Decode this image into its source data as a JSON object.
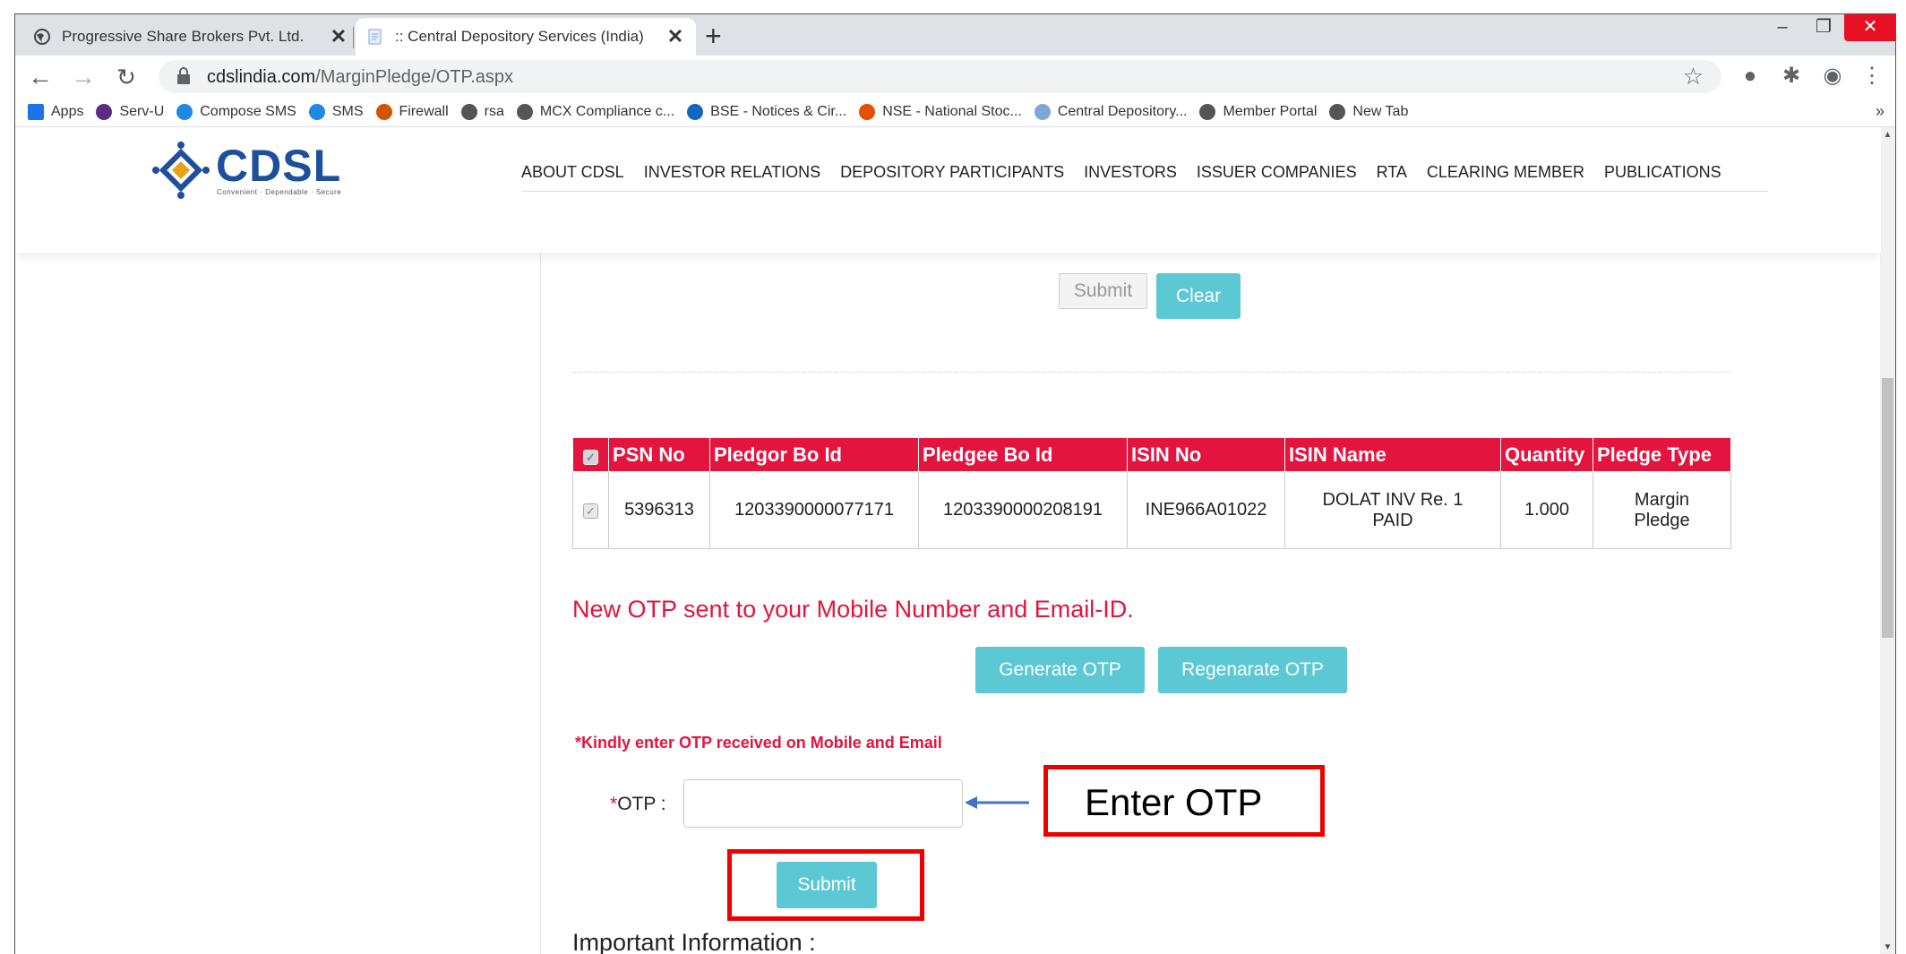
{
  "browser": {
    "tabs": [
      {
        "title": "Progressive Share Brokers Pvt. Ltd.",
        "active": false
      },
      {
        "title": ":: Central Depository Services (India)",
        "active": true
      }
    ],
    "new_tab_symbol": "+",
    "window_controls": {
      "minimize": "–",
      "maximize": "❐",
      "close": "✕"
    },
    "url_host": "cdslindia.com",
    "url_path": "/MarginPledge/OTP.aspx",
    "bookmarks": [
      {
        "label": "Apps",
        "icon": "apps-grid-icon",
        "color": "#1a73e8"
      },
      {
        "label": "Serv-U",
        "icon": "servu-icon",
        "color": "#5a2d82"
      },
      {
        "label": "Compose SMS",
        "icon": "sms-icon",
        "color": "#1e88e5"
      },
      {
        "label": "SMS",
        "icon": "sms-icon",
        "color": "#1e88e5"
      },
      {
        "label": "Firewall",
        "icon": "firewall-icon",
        "color": "#d35400"
      },
      {
        "label": "rsa",
        "icon": "globe-icon",
        "color": "#555555"
      },
      {
        "label": "MCX Compliance c...",
        "icon": "globe-icon",
        "color": "#555555"
      },
      {
        "label": "BSE - Notices & Cir...",
        "icon": "bse-icon",
        "color": "#1565c0"
      },
      {
        "label": "NSE - National Stoc...",
        "icon": "nse-icon",
        "color": "#e65100"
      },
      {
        "label": "Central Depository...",
        "icon": "document-icon",
        "color": "#7ea7d8"
      },
      {
        "label": "Member Portal",
        "icon": "globe-icon",
        "color": "#555555"
      },
      {
        "label": "New Tab",
        "icon": "globe-icon",
        "color": "#555555"
      }
    ],
    "bookmarks_more": "»"
  },
  "site": {
    "logo_text": "CDSL",
    "logo_tagline": "Convenient  ·  Dependable  ·  Secure",
    "nav": [
      "ABOUT CDSL",
      "INVESTOR RELATIONS",
      "DEPOSITORY PARTICIPANTS",
      "INVESTORS",
      "ISSUER COMPANIES",
      "RTA",
      "CLEARING MEMBER",
      "PUBLICATIONS"
    ]
  },
  "form": {
    "submit_label": "Submit",
    "clear_label": "Clear"
  },
  "table": {
    "headers": [
      "PSN No",
      "Pledgor Bo Id",
      "Pledgee Bo Id",
      "ISIN No",
      "ISIN Name",
      "Quantity",
      "Pledge Type"
    ],
    "rows": [
      {
        "psn_no": "5396313",
        "pledgor_bo_id": "1203390000077171",
        "pledgee_bo_id": "1203390000208191",
        "isin_no": "INE966A01022",
        "isin_name": "DOLAT INV Re. 1 PAID",
        "quantity": "1.000",
        "pledge_type": "Margin Pledge"
      }
    ],
    "header_color": "#e3143d"
  },
  "otp": {
    "message": "New OTP sent to your Mobile Number and Email-ID.",
    "generate_label": "Generate OTP",
    "regenerate_label": "Regenarate OTP",
    "hint": "*Kindly enter OTP received on Mobile and Email",
    "label_required": "*",
    "label": "OTP :",
    "value": "",
    "submit_label": "Submit"
  },
  "annotation": {
    "text": "Enter OTP",
    "color": "#ee0000"
  },
  "important_heading": "Important Information :",
  "colors": {
    "accent_teal": "#5bc8d4",
    "alert_red": "#e3143d",
    "brand_blue": "#1d4f9c"
  }
}
